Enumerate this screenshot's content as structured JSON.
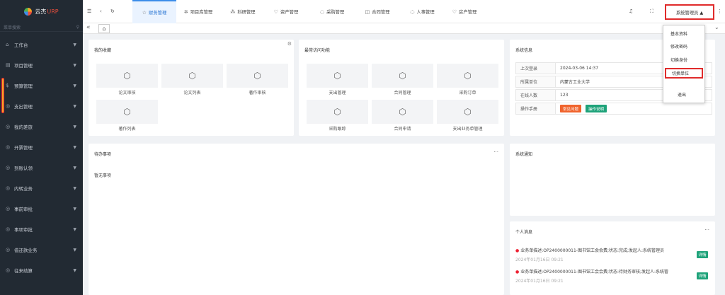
{
  "brand": {
    "name": "云杰",
    "suffix": "URP"
  },
  "sidebar": {
    "search_placeholder": "菜单搜索",
    "items": [
      {
        "label": "工作台",
        "icon": "⌂"
      },
      {
        "label": "项目管理",
        "icon": "▤"
      },
      {
        "label": "预算管理",
        "icon": "$"
      },
      {
        "label": "支出管理",
        "icon": "◎"
      },
      {
        "label": "我的差旅",
        "icon": "◎"
      },
      {
        "label": "开票管理",
        "icon": "◎"
      },
      {
        "label": "到账认领",
        "icon": "◎"
      },
      {
        "label": "内转业务",
        "icon": "◎"
      },
      {
        "label": "事前审批",
        "icon": "◎"
      },
      {
        "label": "事项审批",
        "icon": "◎"
      },
      {
        "label": "借还款业务",
        "icon": "◎"
      },
      {
        "label": "往来结算",
        "icon": "◎"
      }
    ]
  },
  "topbar": {
    "modules": [
      {
        "label": "财务管理",
        "icon": "☆"
      },
      {
        "label": "项目库管理",
        "icon": "✲"
      },
      {
        "label": "科研管理",
        "icon": "⁂"
      },
      {
        "label": "资产管理",
        "icon": "♡"
      },
      {
        "label": "采购管理",
        "icon": "◌"
      },
      {
        "label": "合同管理",
        "icon": "◫"
      },
      {
        "label": "人事管理",
        "icon": "◌"
      },
      {
        "label": "房产管理",
        "icon": "♡"
      }
    ],
    "user_label": "系统管理员 ▲"
  },
  "favorites": {
    "title": "我的收藏",
    "items": [
      "论文审核",
      "论文列表",
      "著作审核",
      "著作列表"
    ]
  },
  "frequent": {
    "title": "最常访问功能",
    "items": [
      "支出管理",
      "合同管理",
      "采购订单",
      "采购跟踪",
      "合同申请",
      "支出业务单管理"
    ]
  },
  "sysinfo": {
    "title": "系统信息",
    "rows": [
      {
        "k": "上次登录",
        "v": "2024-03-06 14:37"
      },
      {
        "k": "所属单位",
        "v": "内蒙古工业大学"
      },
      {
        "k": "在线人数",
        "v": "123"
      },
      {
        "k": "操作手册",
        "v": ""
      }
    ],
    "btn_faq": "常见问题",
    "btn_manual": "操作说明"
  },
  "dropdown": {
    "items": [
      "基本资料",
      "修改密码",
      "切换身份",
      "切换单位",
      "退出"
    ]
  },
  "todo": {
    "title": "待办事项",
    "empty": "暂无事项",
    "more": "···"
  },
  "notice": {
    "title": "系统通知"
  },
  "messages": {
    "title": "个人消息",
    "more": "···",
    "detail_label": "详情",
    "items": [
      {
        "text": "业务单描述:OP2400000011-图书馆工会会费;状态:完成;发起人:系统管理员",
        "time": "2024年01月16日 09:21"
      },
      {
        "text": "业务单描述:OP2400000011-图书馆工会会费;状态:待财务审核;发起人:系统管",
        "time": "2024年01月16日 09:21"
      }
    ]
  }
}
